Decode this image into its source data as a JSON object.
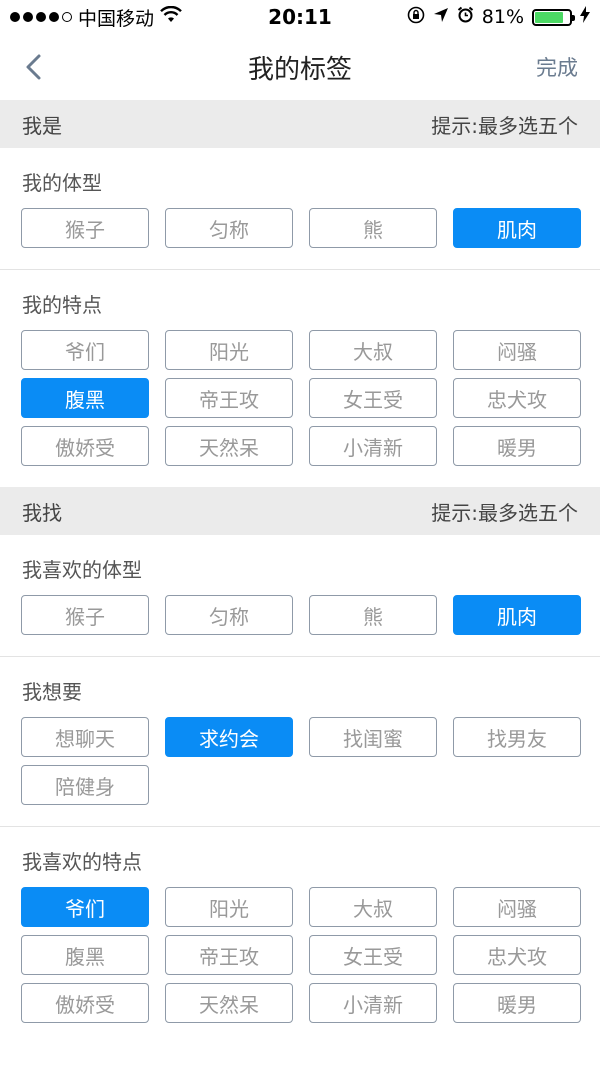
{
  "status": {
    "carrier": "中国移动",
    "time": "20:11",
    "battery": "81%",
    "battery_level": 0.81
  },
  "nav": {
    "title": "我的标签",
    "done": "完成"
  },
  "sections": [
    {
      "title": "我是",
      "hint": "提示:最多选五个",
      "groups": [
        {
          "label": "我的体型",
          "tags": [
            {
              "label": "猴子",
              "selected": false
            },
            {
              "label": "匀称",
              "selected": false
            },
            {
              "label": "熊",
              "selected": false
            },
            {
              "label": "肌肉",
              "selected": true
            }
          ]
        },
        {
          "label": "我的特点",
          "tags": [
            {
              "label": "爷们",
              "selected": false
            },
            {
              "label": "阳光",
              "selected": false
            },
            {
              "label": "大叔",
              "selected": false
            },
            {
              "label": "闷骚",
              "selected": false
            },
            {
              "label": "腹黑",
              "selected": true
            },
            {
              "label": "帝王攻",
              "selected": false
            },
            {
              "label": "女王受",
              "selected": false
            },
            {
              "label": "忠犬攻",
              "selected": false
            },
            {
              "label": "傲娇受",
              "selected": false
            },
            {
              "label": "天然呆",
              "selected": false
            },
            {
              "label": "小清新",
              "selected": false
            },
            {
              "label": "暖男",
              "selected": false
            }
          ]
        }
      ]
    },
    {
      "title": "我找",
      "hint": "提示:最多选五个",
      "groups": [
        {
          "label": "我喜欢的体型",
          "tags": [
            {
              "label": "猴子",
              "selected": false
            },
            {
              "label": "匀称",
              "selected": false
            },
            {
              "label": "熊",
              "selected": false
            },
            {
              "label": "肌肉",
              "selected": true
            }
          ]
        },
        {
          "label": "我想要",
          "tags": [
            {
              "label": "想聊天",
              "selected": false
            },
            {
              "label": "求约会",
              "selected": true
            },
            {
              "label": "找闺蜜",
              "selected": false
            },
            {
              "label": "找男友",
              "selected": false
            },
            {
              "label": "陪健身",
              "selected": false
            }
          ]
        },
        {
          "label": "我喜欢的特点",
          "tags": [
            {
              "label": "爷们",
              "selected": true
            },
            {
              "label": "阳光",
              "selected": false
            },
            {
              "label": "大叔",
              "selected": false
            },
            {
              "label": "闷骚",
              "selected": false
            },
            {
              "label": "腹黑",
              "selected": false
            },
            {
              "label": "帝王攻",
              "selected": false
            },
            {
              "label": "女王受",
              "selected": false
            },
            {
              "label": "忠犬攻",
              "selected": false
            },
            {
              "label": "傲娇受",
              "selected": false
            },
            {
              "label": "天然呆",
              "selected": false
            },
            {
              "label": "小清新",
              "selected": false
            },
            {
              "label": "暖男",
              "selected": false
            }
          ]
        }
      ]
    }
  ],
  "colors": {
    "accent": "#0a8cf5",
    "section_bg": "#ebebeb",
    "battery_green": "#4cd964"
  }
}
